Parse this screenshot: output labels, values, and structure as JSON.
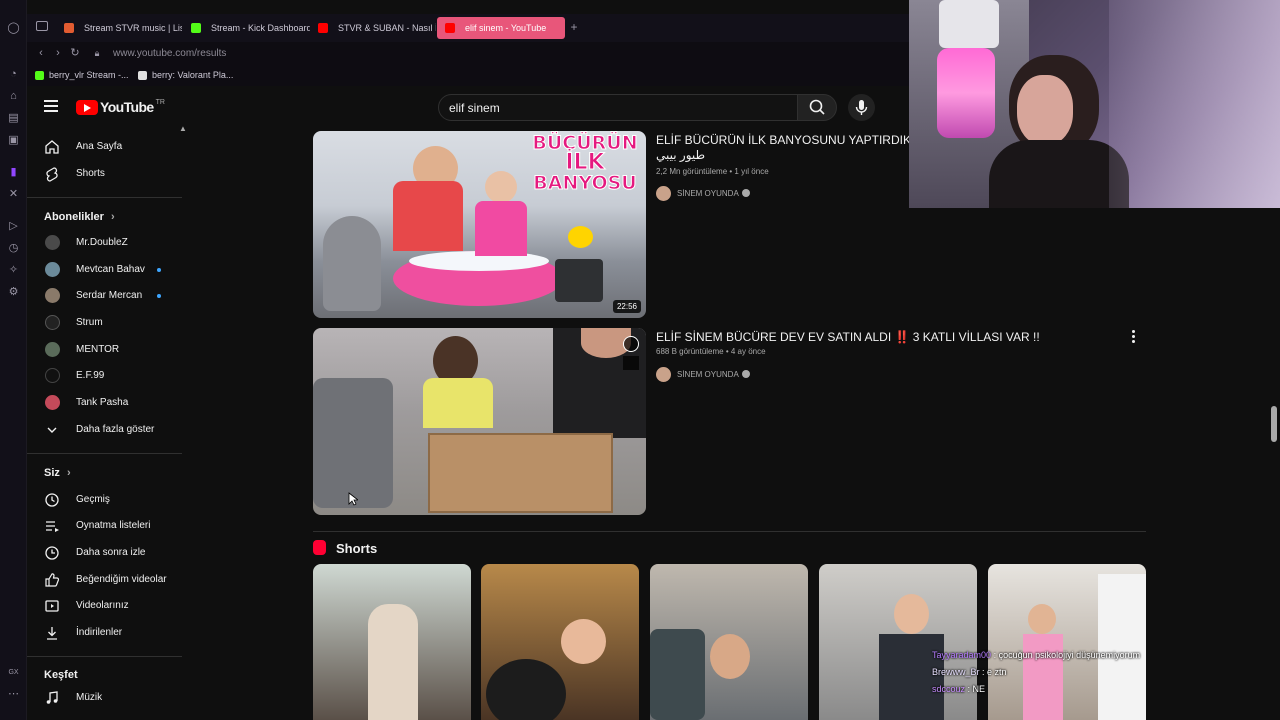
{
  "browser": {
    "tabs": [
      {
        "label": "Stream STVR music | Liste",
        "color": "#e25c31"
      },
      {
        "label": "Stream - Kick Dashboard",
        "color": "#53fc18"
      },
      {
        "label": "STVR & SUBAN - Nasıl İste",
        "color": "#ff0000"
      },
      {
        "label": "elif sinem - YouTube",
        "color": "#ff0000"
      }
    ],
    "url": "www.youtube.com/results",
    "bookmarks": [
      {
        "label": "berry_vlr Stream -...",
        "color": "#53fc18"
      },
      {
        "label": "berry: Valorant Pla...",
        "color": "#e0e0e0"
      }
    ],
    "accent": "#e8567a"
  },
  "masthead": {
    "logo_text": "YouTube",
    "logo_region": "TR",
    "search_value": "elif sinem"
  },
  "sidebar": {
    "main": [
      {
        "label": "Ana Sayfa",
        "icon": "home-icon"
      },
      {
        "label": "Shorts",
        "icon": "shorts-icon"
      }
    ],
    "subscriptions_title": "Abonelikler",
    "subscriptions": [
      {
        "label": "Mr.DoubleZ",
        "dot": false,
        "color": "#4a4a4a"
      },
      {
        "label": "Mevtcan Bahav",
        "dot": true,
        "color": "#6b8a9a"
      },
      {
        "label": "Serdar Mercan",
        "dot": true,
        "color": "#8a7a6a"
      },
      {
        "label": "Strum",
        "dot": false,
        "color": "#222222"
      },
      {
        "label": "MENTOR",
        "dot": false,
        "color": "#5a6b5a"
      },
      {
        "label": "E.F.99",
        "dot": false,
        "color": "#111111"
      },
      {
        "label": "Tank Pasha",
        "dot": false,
        "color": "#c44a5a"
      }
    ],
    "show_more": "Daha fazla göster",
    "you_title": "Siz",
    "you_items": [
      {
        "label": "Geçmiş",
        "icon": "history-icon"
      },
      {
        "label": "Oynatma listeleri",
        "icon": "playlists-icon"
      },
      {
        "label": "Daha sonra izle",
        "icon": "watch-later-icon"
      },
      {
        "label": "Beğendiğim videolar",
        "icon": "liked-icon"
      },
      {
        "label": "Videolarınız",
        "icon": "your-videos-icon"
      },
      {
        "label": "İndirilenler",
        "icon": "downloads-icon"
      }
    ],
    "explore_title": "Keşfet",
    "explore_items": [
      {
        "label": "Müzik",
        "icon": "music-icon"
      }
    ]
  },
  "results": [
    {
      "title": "ELİF BÜCÜRÜN İLK BANYOSUNU YAPTIRDIK !! E",
      "title_line2": "طيور بيبي",
      "meta": "2,2 Mn görüntüleme • 1 yıl önce",
      "channel": "SİNEM OYUNDA",
      "duration": "22:56",
      "thumb_text_1": "BÜCÜRÜN",
      "thumb_text_2": "İLK",
      "thumb_text_3": "BANYOSU"
    },
    {
      "title": "ELİF SİNEM BÜCÜRE DEV EV SATIN ALDI ‼️ 3 KATLI VİLLASI VAR !!",
      "meta": "688 B görüntüleme • 4 ay önce",
      "channel": "SİNEM OYUNDA"
    }
  ],
  "shorts": {
    "title": "Shorts",
    "items": [
      {
        "color_top": "#cfd8d2",
        "color_bottom": "#5a5048"
      },
      {
        "color_top": "#b8894a",
        "color_bottom": "#4a3424"
      },
      {
        "color_top": "#bfb8ae",
        "color_bottom": "#6a6e72"
      },
      {
        "color_top": "#cfcdc9",
        "color_bottom": "#8a8a8a"
      },
      {
        "color_top": "#e7e4df",
        "color_bottom": "#a69a8e"
      }
    ]
  },
  "chat": [
    {
      "user": "Tayyaradam00",
      "text": ": çocuğun psikolojiyi düşünemiyorum"
    },
    {
      "user": "Brewww_Br",
      "text": ": e ztn"
    },
    {
      "user": "sdccouz",
      "text": ": NE"
    }
  ]
}
